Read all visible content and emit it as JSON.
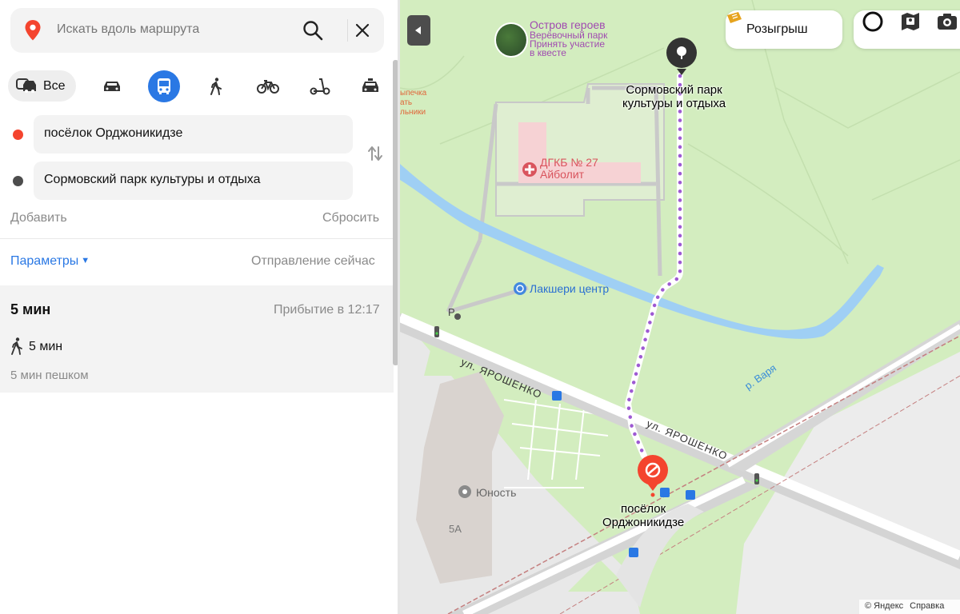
{
  "search": {
    "placeholder": "Искать вдоль маршрута"
  },
  "modes": {
    "all_label": "Все"
  },
  "route": {
    "from": "посёлок Орджоникидзе",
    "to": "Сормовский парк культуры и отдыха",
    "add_label": "Добавить",
    "reset_label": "Сбросить"
  },
  "options": {
    "params_label": "Параметры",
    "departure_label": "Отправление сейчас"
  },
  "result": {
    "duration": "5 мин",
    "arrival": "Прибытие в 12:17",
    "walk_duration": "5 мин",
    "walk_description": "5 мин пешком"
  },
  "map": {
    "promo_label": "Розыгрыш",
    "poi_heroes_title": "Остров героев",
    "poi_heroes_line1": "Верёвочный парк",
    "poi_heroes_line2": "Принять участие",
    "poi_heroes_line3": "в квесте",
    "partial_line1": "ыпечка",
    "partial_line2": "ать",
    "partial_line3": "льники",
    "hospital_line1": "ДГКБ № 27",
    "hospital_line2": "Айболит",
    "lux_center": "Лакшери центр",
    "parking": "P",
    "destination_line1": "Сормовский парк",
    "destination_line2": "культуры и отдыха",
    "street_1": "ул. ЯРОШЕНКО",
    "street_2": "ул. ЯРОШЕНКО",
    "river": "р. Варя",
    "cinema": "Юность",
    "building_number": "5А",
    "origin_line1": "посёлок",
    "origin_line2": "Орджоникидзе",
    "copyright": "© Яндекс",
    "help_link": "Справка"
  },
  "colors": {
    "accent": "#2a78e4",
    "origin_dot": "#f4442e",
    "destination_dot": "#4d4d4d",
    "route_line": "#9e5ad3"
  }
}
